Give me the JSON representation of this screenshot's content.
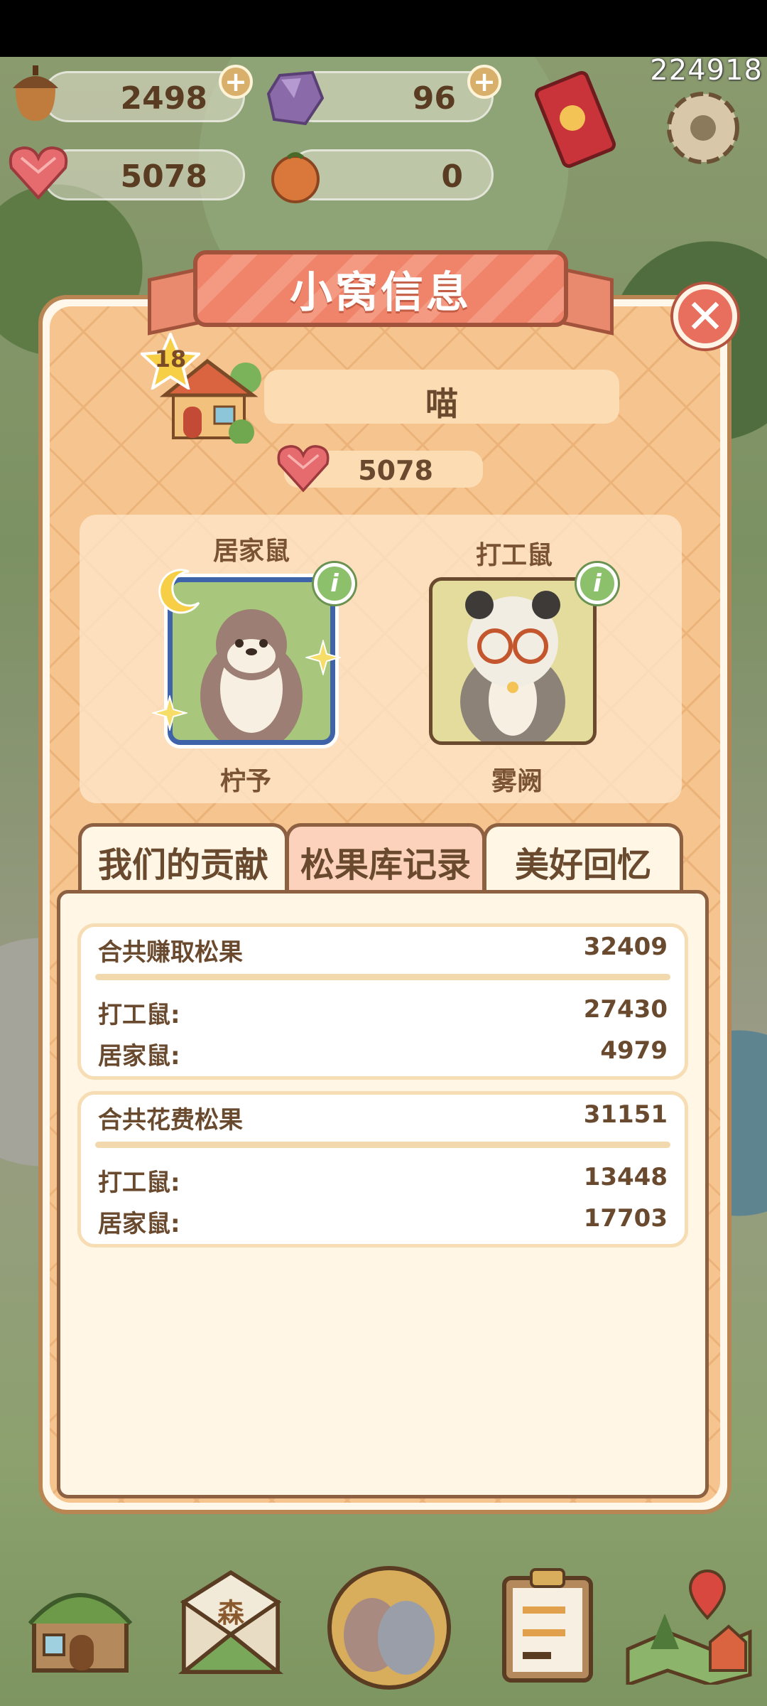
{
  "overlay_code": "224918",
  "currencies": [
    {
      "name": "acorn",
      "value": "2498",
      "has_plus": true
    },
    {
      "name": "crystal",
      "value": "96",
      "has_plus": true
    },
    {
      "name": "heart-gem",
      "value": "5078",
      "has_plus": false
    },
    {
      "name": "persimmon",
      "value": "0",
      "has_plus": false
    }
  ],
  "panel": {
    "title": "小窝信息",
    "close_label": "✕",
    "level": "18",
    "nest_name": "喵",
    "hearts": "5078",
    "pets": [
      {
        "role": "居家鼠",
        "name": "柠予"
      },
      {
        "role": "打工鼠",
        "name": "雾阙"
      }
    ],
    "info_label": "i",
    "tabs": [
      "我们的贡献",
      "松果库记录",
      "美好回忆"
    ],
    "active_tab": 1,
    "records": [
      {
        "title": "合共赚取松果",
        "total": "32409",
        "rows": [
          {
            "label": "打工鼠:",
            "value": "27430"
          },
          {
            "label": "居家鼠:",
            "value": "4979"
          }
        ]
      },
      {
        "title": "合共花费松果",
        "total": "31151",
        "rows": [
          {
            "label": "打工鼠:",
            "value": "13448"
          },
          {
            "label": "居家鼠:",
            "value": "17703"
          }
        ]
      }
    ]
  },
  "bottom_nav": [
    {
      "icon": "house-icon"
    },
    {
      "icon": "mail-icon",
      "text": "森"
    },
    {
      "icon": "birds-icon"
    },
    {
      "icon": "clipboard-icon"
    },
    {
      "icon": "map-icon"
    }
  ]
}
